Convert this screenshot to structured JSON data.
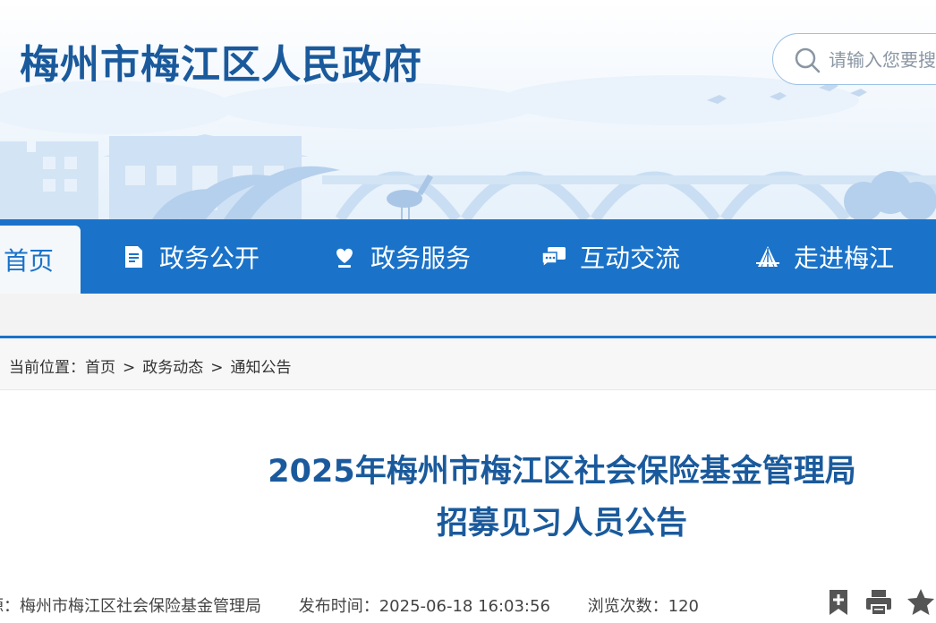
{
  "header": {
    "site_title": "梅州市梅江区人民政府",
    "search_placeholder": "请输入您要搜索的内容"
  },
  "nav": {
    "items": [
      {
        "label": "首页",
        "icon": "home",
        "active": true
      },
      {
        "label": "政务公开",
        "icon": "document-icon"
      },
      {
        "label": "政务服务",
        "icon": "heart-hand-icon"
      },
      {
        "label": "互动交流",
        "icon": "chat-icon"
      },
      {
        "label": "走进梅江",
        "icon": "bridge-icon"
      }
    ]
  },
  "breadcrumb": {
    "prefix": "当前位置：",
    "items": [
      "首页",
      "政务动态",
      "通知公告"
    ],
    "separator": ">"
  },
  "article": {
    "title_line1": "2025年梅州市梅江区社会保险基金管理局",
    "title_line2": "招募见习人员公告",
    "source_label": "来源：",
    "source": "梅州市梅江区社会保险基金管理局",
    "publish_label": "发布时间：",
    "publish_time": "2025-06-18 16:03:56",
    "views_label": "浏览次数：",
    "views": "120"
  },
  "colors": {
    "primary": "#1a73c9",
    "title": "#1a5a9c"
  }
}
